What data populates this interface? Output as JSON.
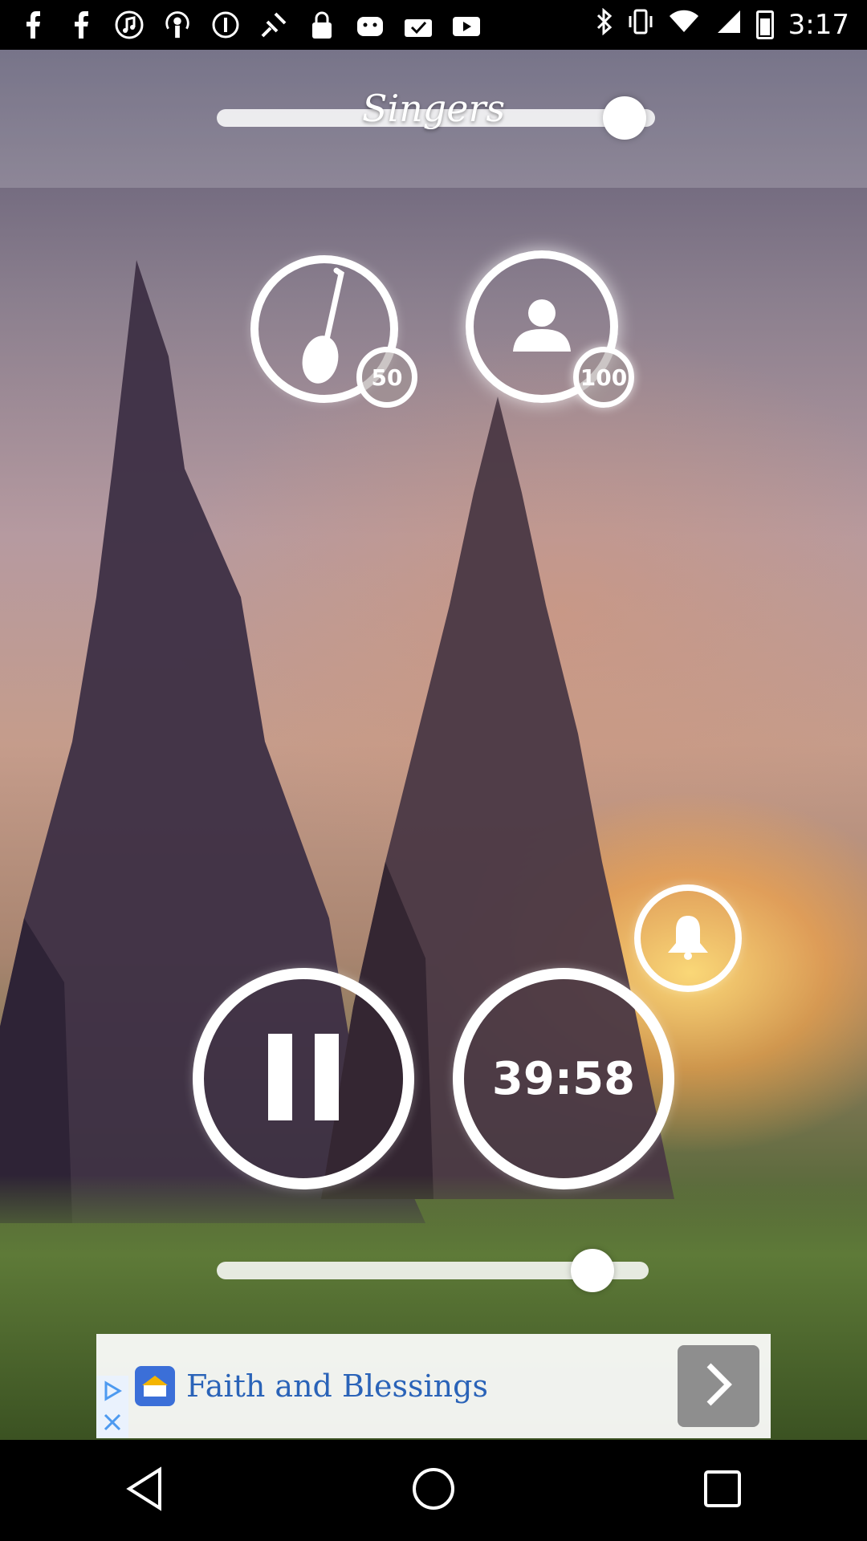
{
  "status_bar": {
    "time": "3:17",
    "icons": [
      "facebook-icon",
      "facebook-icon",
      "music-icon",
      "podcast-icon",
      "info-icon",
      "satellite-icon",
      "lock-icon",
      "android-icon",
      "check-bag-icon",
      "youtube-icon"
    ]
  },
  "header": {
    "title": "Singers",
    "top_slider_level": 0.93
  },
  "controls": {
    "instrument_count": "50",
    "singer_count": "100",
    "timer": "39:58",
    "bottom_slider_level": 0.87
  },
  "ad": {
    "text": "Faith and Blessings"
  },
  "colors": {
    "ad_text": "#2a63b8",
    "ad_arrow_bg": "#8e8e8e"
  }
}
